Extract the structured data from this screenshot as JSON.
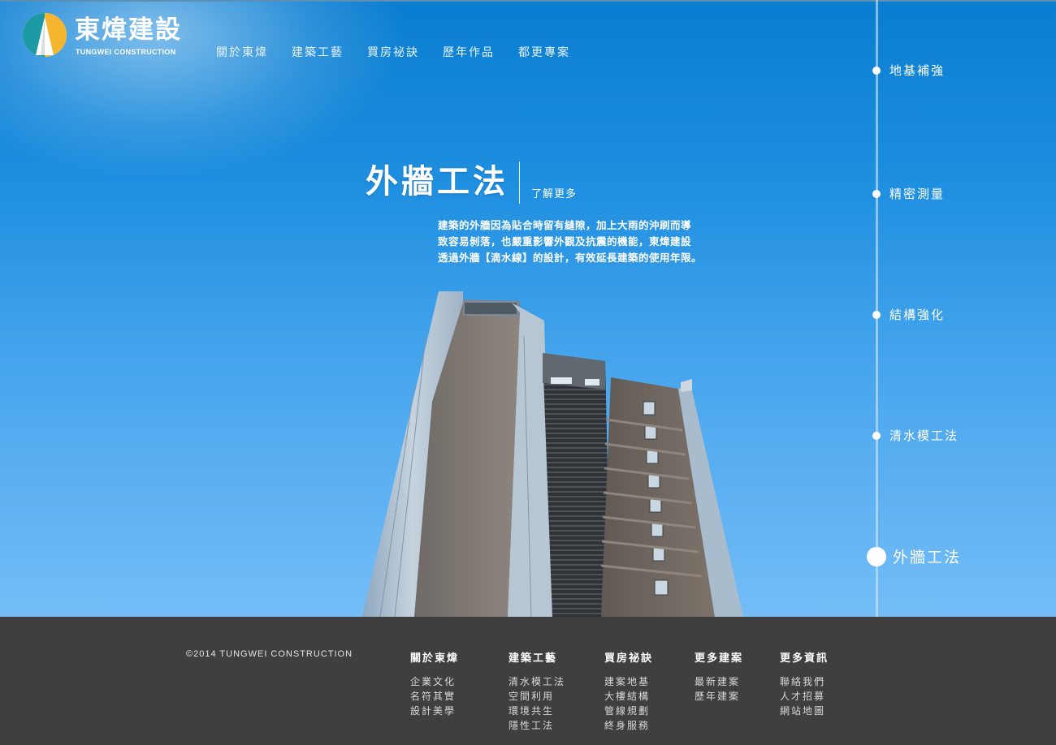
{
  "logo": {
    "name_cn": "東煒建設",
    "name_en": "TUNGWEI CONSTRUCTION"
  },
  "nav": {
    "items": [
      "關於東煒",
      "建築工藝",
      "買房祕訣",
      "歷年作品",
      "都更專案"
    ]
  },
  "hero": {
    "title": "外牆工法",
    "more": "了解更多",
    "description": [
      "建築的外牆因為貼合時留有縫隙，加上大雨的沖刷而導",
      "致容易剝落，也嚴重影響外觀及抗震的機能，東煒建設",
      "透過外牆【滴水線】的設計，有效延長建築的使用年限。"
    ]
  },
  "timeline": {
    "items": [
      "地基補強",
      "精密測量",
      "結構強化",
      "清水模工法",
      "外牆工法"
    ],
    "active": "外牆工法"
  },
  "footer": {
    "copyright": "©2014 TUNGWEI CONSTRUCTION",
    "columns": [
      {
        "title": "關於東煒",
        "links": [
          "企業文化",
          "名符其實",
          "設計美學"
        ]
      },
      {
        "title": "建築工藝",
        "links": [
          "清水模工法",
          "空間利用",
          "環境共生",
          "隱性工法"
        ]
      },
      {
        "title": "買房祕訣",
        "links": [
          "建案地基",
          "大樓結構",
          "管線規劃",
          "終身服務"
        ]
      },
      {
        "title": "更多建案",
        "links": [
          "最新建案",
          "歷年建案"
        ]
      },
      {
        "title": "更多資訊",
        "links": [
          "聯絡我們",
          "人才招募",
          "網站地圖"
        ]
      }
    ]
  },
  "colors": {
    "sky_top": "#0a7dd0",
    "sky_bottom": "#74bdf7",
    "footer_bg": "#3f3f3f",
    "logo_teal": "#1b9aa6",
    "logo_yellow": "#f5b52e"
  }
}
